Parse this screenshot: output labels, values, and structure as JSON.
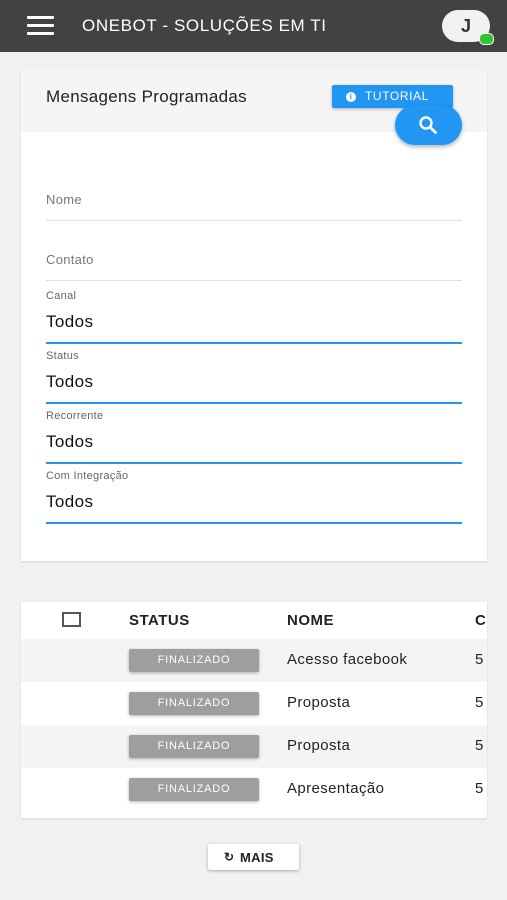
{
  "appbar": {
    "title": "ONEBOT - SOLUÇÕES EM TI",
    "avatar_initial": "J"
  },
  "filter": {
    "title": "Mensagens Programadas",
    "tutorial_label": "TUTORIAL",
    "name_placeholder": "Nome",
    "contact_placeholder": "Contato",
    "selects": [
      {
        "label": "Canal",
        "value": "Todos"
      },
      {
        "label": "Status",
        "value": "Todos"
      },
      {
        "label": "Recorrente",
        "value": "Todos"
      },
      {
        "label": "Com Integração",
        "value": "Todos"
      }
    ]
  },
  "table": {
    "columns": [
      "STATUS",
      "NOME",
      "C"
    ],
    "rows": [
      {
        "status": "FINALIZADO",
        "name": "Acesso facebook",
        "c": "5"
      },
      {
        "status": "FINALIZADO",
        "name": "Proposta",
        "c": "5"
      },
      {
        "status": "FINALIZADO",
        "name": "Proposta",
        "c": "5"
      },
      {
        "status": "FINALIZADO",
        "name": "Apresentação",
        "c": "5"
      }
    ]
  },
  "more_button": {
    "icon": "refresh-icon",
    "label": "MAIS"
  },
  "colors": {
    "appbar": "#424242",
    "accent": "#2196f3",
    "badge": "#9e9e9e",
    "online": "#36c236"
  }
}
